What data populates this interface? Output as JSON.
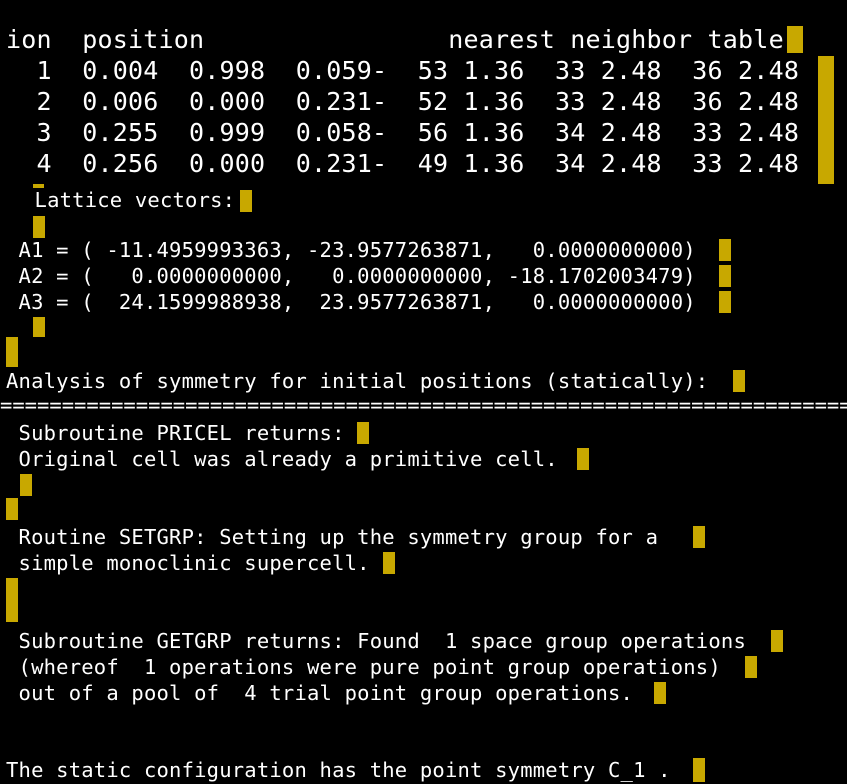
{
  "header": {
    "text": "ion  position                nearest neighbor table"
  },
  "ions": [
    "  1  0.004  0.998  0.059-  53 1.36  33 2.48  36 2.48",
    "  2  0.006  0.000  0.231-  52 1.36  33 2.48  36 2.48",
    "  3  0.255  0.999  0.058-  56 1.36  34 2.48  33 2.48",
    "  4  0.256  0.000  0.231-  49 1.36  34 2.48  33 2.48"
  ],
  "lattice": {
    "title": " Lattice vectors:",
    "a1": " A1 = ( -11.4959993363, -23.9577263871,   0.0000000000)",
    "a2": " A2 = (   0.0000000000,   0.0000000000, -18.1702003479)",
    "a3": " A3 = (  24.1599988938,  23.9577263871,   0.0000000000)"
  },
  "analysis": {
    "title": "Analysis of symmetry for initial positions (statically):",
    "separator": "==================================================================================="
  },
  "pricel": {
    "line1": " Subroutine PRICEL returns:",
    "line2": " Original cell was already a primitive cell."
  },
  "setgrp": {
    "line1": " Routine SETGRP: Setting up the symmetry group for a ",
    "line2": " simple monoclinic supercell."
  },
  "getgrp": {
    "line1": " Subroutine GETGRP returns: Found  1 space group operations",
    "line2": " (whereof  1 operations were pure point group operations)",
    "line3": " out of a pool of  4 trial point group operations."
  },
  "result": {
    "line": "The static configuration has the point symmetry C_1 ."
  },
  "colors": {
    "background": "#000000",
    "text": "#ffffff",
    "cursor": "#c8a800"
  }
}
